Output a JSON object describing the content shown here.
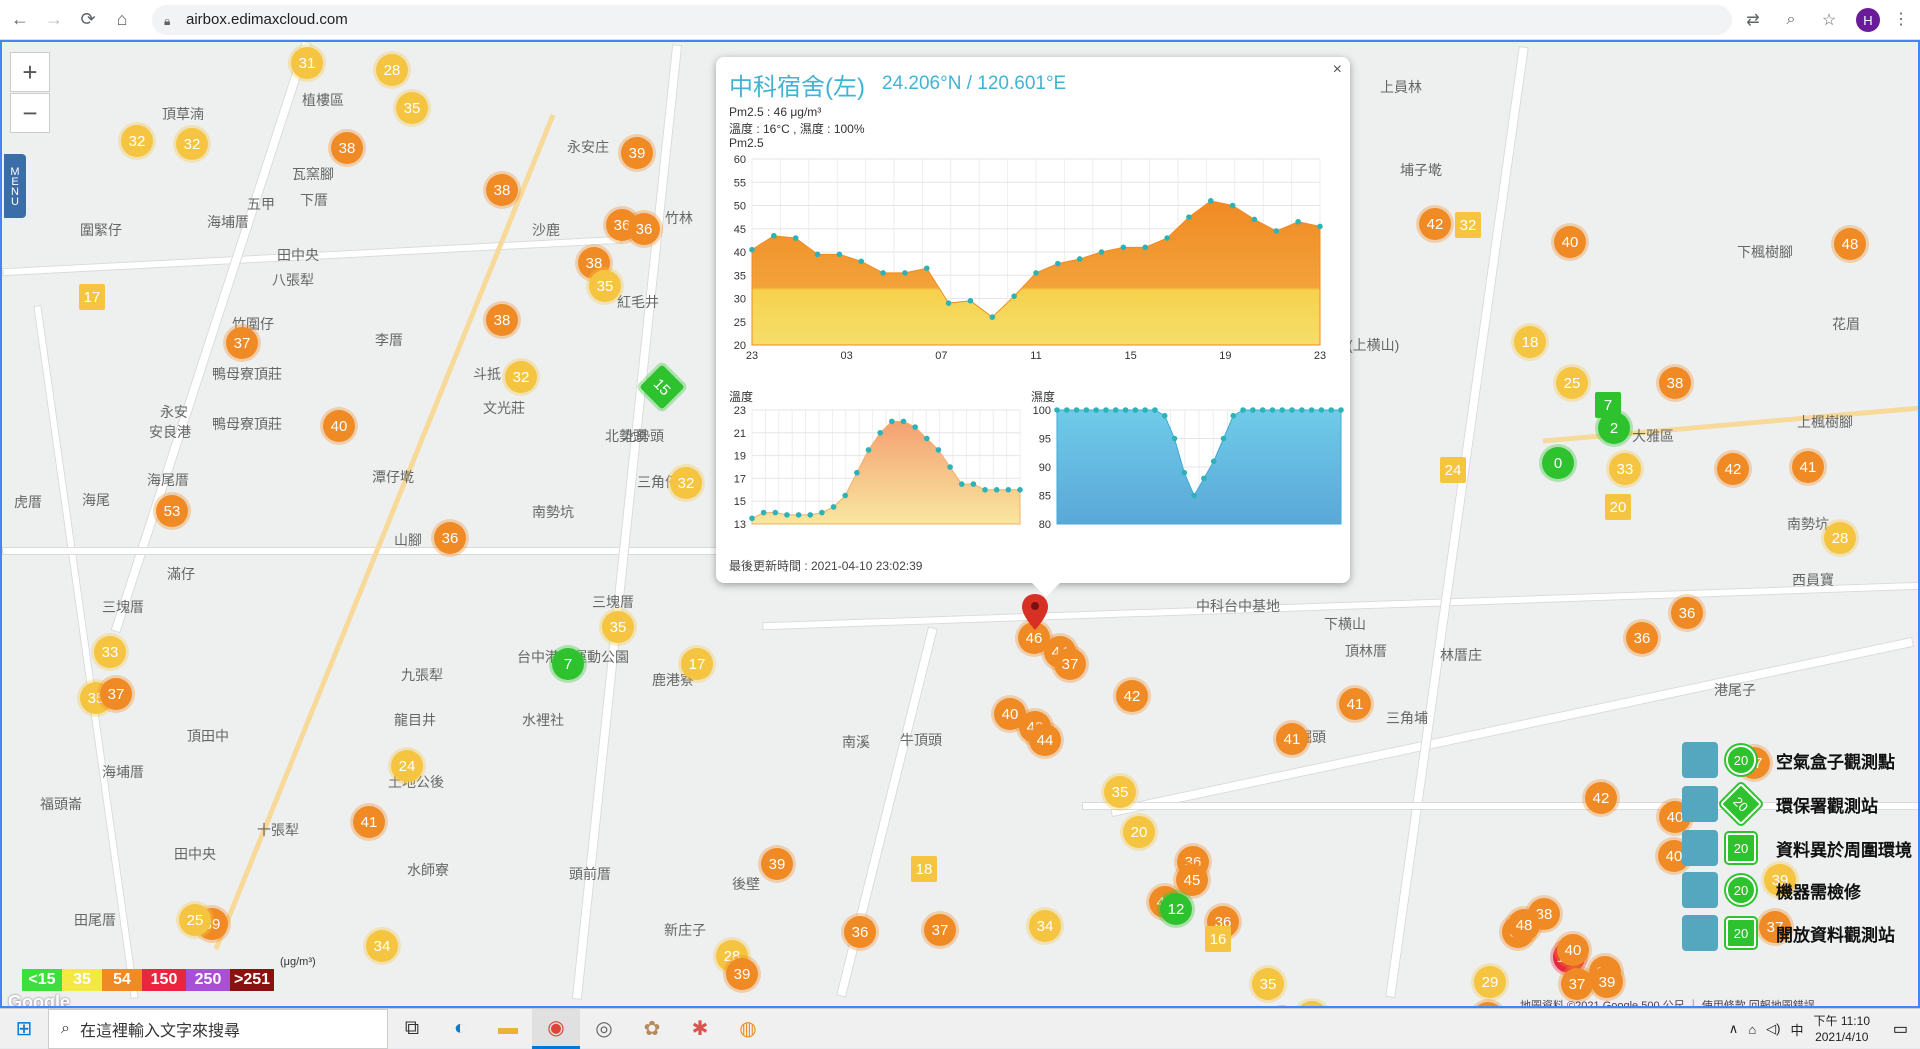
{
  "browser": {
    "url": "airbox.edimaxcloud.com",
    "avatar_letter": "H"
  },
  "map": {
    "menu_label": "MENU",
    "zoom_in": "+",
    "zoom_out": "−",
    "labels": [
      {
        "text": "植樓區"
      },
      {
        "text": "頂草湳"
      },
      {
        "text": "瓦窯腳"
      },
      {
        "text": "下厝"
      },
      {
        "text": "五甲"
      },
      {
        "text": "圍緊仔"
      },
      {
        "text": "海埔厝"
      },
      {
        "text": "田中央"
      },
      {
        "text": "八張犁"
      },
      {
        "text": "竹圍仔"
      },
      {
        "text": "鴨母寮頂莊"
      },
      {
        "text": "永安"
      },
      {
        "text": "安良港"
      },
      {
        "text": "鴨母寮頂莊"
      },
      {
        "text": "海尾厝"
      },
      {
        "text": "虎厝"
      },
      {
        "text": "海尾"
      },
      {
        "text": "滿仔"
      },
      {
        "text": "三塊厝"
      },
      {
        "text": "頂田中"
      },
      {
        "text": "海埔厝"
      },
      {
        "text": "福頭崙"
      },
      {
        "text": "田中央"
      },
      {
        "text": "田尾厝"
      },
      {
        "text": "南勢坑"
      },
      {
        "text": "山腳"
      },
      {
        "text": "九張犁"
      },
      {
        "text": "龍目井"
      },
      {
        "text": "水裡社"
      },
      {
        "text": "土地公後"
      },
      {
        "text": "十張犁"
      },
      {
        "text": "水師寮"
      },
      {
        "text": "頭前厝"
      },
      {
        "text": "後壁"
      },
      {
        "text": "新庄子"
      },
      {
        "text": "牛頂頭"
      },
      {
        "text": "中科台中基地"
      },
      {
        "text": "下横山"
      },
      {
        "text": "頂林厝"
      },
      {
        "text": "林厝庄"
      },
      {
        "text": "三角埔"
      },
      {
        "text": "秀山(上横山)"
      },
      {
        "text": "上員林"
      },
      {
        "text": "埔子墘"
      },
      {
        "text": "下楓樹腳"
      },
      {
        "text": "花眉"
      },
      {
        "text": "上楓樹腳"
      },
      {
        "text": "大雅區"
      },
      {
        "text": "南勢坑"
      },
      {
        "text": "西員寶"
      },
      {
        "text": "港尾子"
      },
      {
        "text": "水崛頭"
      },
      {
        "text": "三角仔"
      },
      {
        "text": "北勢頭"
      },
      {
        "text": "紅毛井"
      },
      {
        "text": "李厝"
      },
      {
        "text": "斗抵"
      },
      {
        "text": "文光莊"
      },
      {
        "text": "潭仔墘"
      },
      {
        "text": "永安庄"
      },
      {
        "text": "沙鹿"
      },
      {
        "text": "竹林"
      },
      {
        "text": "北勢頭"
      },
      {
        "text": "台中港區運動公園"
      },
      {
        "text": "鹿港寮"
      },
      {
        "text": "三塊厝"
      },
      {
        "text": "南溪"
      }
    ],
    "markers": [
      {
        "v": "31",
        "c": "#f5c542"
      },
      {
        "v": "28",
        "c": "#f5c542"
      },
      {
        "v": "35",
        "c": "#f5c542"
      },
      {
        "v": "32",
        "c": "#f5c542"
      },
      {
        "v": "38",
        "c": "#f08a24"
      },
      {
        "v": "32",
        "c": "#f5c542"
      },
      {
        "v": "38",
        "c": "#f08a24"
      },
      {
        "v": "39",
        "c": "#f08a24"
      },
      {
        "v": "36",
        "c": "#f08a24"
      },
      {
        "v": "36",
        "c": "#f08a24"
      },
      {
        "v": "38",
        "c": "#f08a24"
      },
      {
        "v": "35",
        "c": "#f5c542"
      },
      {
        "v": "37",
        "c": "#f08a24"
      },
      {
        "v": "38",
        "c": "#f08a24"
      },
      {
        "v": "32",
        "c": "#f5c542"
      },
      {
        "v": "40",
        "c": "#f08a24"
      },
      {
        "v": "53",
        "c": "#f08a24"
      },
      {
        "v": "36",
        "c": "#f08a24"
      },
      {
        "v": "32",
        "c": "#f5c542"
      },
      {
        "v": "35",
        "c": "#f5c542"
      },
      {
        "v": "7",
        "c": "#2ec22e"
      },
      {
        "v": "33",
        "c": "#f5c542"
      },
      {
        "v": "35",
        "c": "#f5c542"
      },
      {
        "v": "37",
        "c": "#f08a24"
      },
      {
        "v": "17",
        "c": "#f5c542"
      },
      {
        "v": "24",
        "c": "#f5c542"
      },
      {
        "v": "41",
        "c": "#f08a24"
      },
      {
        "v": "39",
        "c": "#f08a24"
      },
      {
        "v": "34",
        "c": "#f5c542"
      },
      {
        "v": "39",
        "c": "#f08a24"
      },
      {
        "v": "28",
        "c": "#f5c542"
      },
      {
        "v": "39",
        "c": "#f08a24"
      },
      {
        "v": "25",
        "c": "#f5c542"
      },
      {
        "v": "46",
        "c": "#f08a24"
      },
      {
        "v": "44",
        "c": "#f08a24"
      },
      {
        "v": "37",
        "c": "#f08a24"
      },
      {
        "v": "40",
        "c": "#f08a24"
      },
      {
        "v": "42",
        "c": "#f08a24"
      },
      {
        "v": "44",
        "c": "#f08a24"
      },
      {
        "v": "42",
        "c": "#f08a24"
      },
      {
        "v": "35",
        "c": "#f5c542"
      },
      {
        "v": "20",
        "c": "#f5c542"
      },
      {
        "v": "36",
        "c": "#f08a24"
      },
      {
        "v": "45",
        "c": "#f08a24"
      },
      {
        "v": "40",
        "c": "#f08a24"
      },
      {
        "v": "12",
        "c": "#2ec22e"
      },
      {
        "v": "36",
        "c": "#f08a24"
      },
      {
        "v": "34",
        "c": "#f5c542"
      },
      {
        "v": "37",
        "c": "#f08a24"
      },
      {
        "v": "36",
        "c": "#f08a24"
      },
      {
        "v": "39",
        "c": "#f08a24"
      },
      {
        "v": "35",
        "c": "#f5c542"
      },
      {
        "v": "33",
        "c": "#f5c542"
      },
      {
        "v": "0",
        "c": "#2ec22e"
      },
      {
        "v": "41",
        "c": "#f08a24"
      },
      {
        "v": "42",
        "c": "#f08a24"
      },
      {
        "v": "40",
        "c": "#f08a24"
      },
      {
        "v": "18",
        "c": "#f5c542"
      },
      {
        "v": "25",
        "c": "#f5c542"
      },
      {
        "v": "38",
        "c": "#f08a24"
      },
      {
        "v": "2",
        "c": "#2ec22e"
      },
      {
        "v": "0",
        "c": "#2ec22e"
      },
      {
        "v": "33",
        "c": "#f5c542"
      },
      {
        "v": "42",
        "c": "#f08a24"
      },
      {
        "v": "41",
        "c": "#f08a24"
      },
      {
        "v": "28",
        "c": "#f5c542"
      },
      {
        "v": "36",
        "c": "#f08a24"
      },
      {
        "v": "36",
        "c": "#f08a24"
      },
      {
        "v": "48",
        "c": "#f08a24"
      },
      {
        "v": "37",
        "c": "#f08a24"
      },
      {
        "v": "41",
        "c": "#f08a24"
      },
      {
        "v": "42",
        "c": "#f08a24"
      },
      {
        "v": "37",
        "c": "#f08a24"
      },
      {
        "v": "40",
        "c": "#f08a24"
      },
      {
        "v": "40",
        "c": "#f08a24"
      },
      {
        "v": "120",
        "c": "#e8273f"
      },
      {
        "v": "39",
        "c": "#f5c542"
      },
      {
        "v": "38",
        "c": "#f08a24"
      },
      {
        "v": "48",
        "c": "#f08a24"
      },
      {
        "v": "37",
        "c": "#f08a24"
      },
      {
        "v": "40",
        "c": "#f08a24"
      },
      {
        "v": "39",
        "c": "#f08a24"
      },
      {
        "v": "37",
        "c": "#f08a24"
      },
      {
        "v": "29",
        "c": "#f5c542"
      },
      {
        "v": "39",
        "c": "#f08a24"
      },
      {
        "v": "37",
        "c": "#f08a24"
      },
      {
        "v": "15",
        "c": "#2ec22e"
      }
    ],
    "sq_markers": [
      {
        "v": "17",
        "c": "#f5c542"
      },
      {
        "v": "32",
        "c": "#f5c542"
      },
      {
        "v": "24",
        "c": "#f5c542"
      },
      {
        "v": "7",
        "c": "#2ec22e"
      },
      {
        "v": "20",
        "c": "#f5c542"
      },
      {
        "v": "18",
        "c": "#f5c542"
      },
      {
        "v": "16",
        "c": "#f5c542"
      }
    ]
  },
  "popup": {
    "title": "中科宿舍(左)",
    "coord": "24.206°N / 120.601°E",
    "pm_line": "Pm2.5 : 46 μg/m³",
    "temp_line": "溫度 : 16°C , 濕度 : 100%",
    "pm_chart_label": "Pm2.5",
    "temp_chart_label": "溫度",
    "humid_chart_label": "濕度",
    "updated": "最後更新時間 : 2021-04-10 23:02:39",
    "close": "×"
  },
  "chart_data": [
    {
      "type": "area",
      "title": "Pm2.5",
      "x_ticks": [
        "23",
        "03",
        "07",
        "11",
        "15",
        "19",
        "23"
      ],
      "ylim": [
        20,
        60
      ],
      "y_ticks": [
        20,
        25,
        30,
        35,
        40,
        45,
        50,
        55,
        60
      ],
      "values": [
        40.5,
        43.5,
        43,
        39.5,
        39.5,
        38,
        35.5,
        35.5,
        36.5,
        29,
        29.5,
        26,
        30.5,
        35.5,
        37.5,
        38.5,
        40,
        41,
        41,
        43,
        47.5,
        51,
        50,
        47,
        44.5,
        46.5,
        45.5
      ]
    },
    {
      "type": "area",
      "title": "溫度",
      "ylim": [
        13,
        23
      ],
      "y_ticks": [
        13,
        15,
        17,
        19,
        21,
        23
      ],
      "values": [
        13.5,
        14,
        14,
        13.8,
        13.8,
        13.8,
        14,
        14.5,
        15.5,
        17.5,
        19.5,
        21,
        22,
        22,
        21.5,
        20.5,
        19.5,
        18,
        16.5,
        16.5,
        16,
        16,
        16,
        16
      ]
    },
    {
      "type": "area",
      "title": "濕度",
      "ylim": [
        80,
        100
      ],
      "y_ticks": [
        80,
        85,
        90,
        95,
        100
      ],
      "values": [
        100,
        100,
        100,
        100,
        100,
        100,
        100,
        100,
        100,
        100,
        100,
        99,
        95,
        89,
        85,
        88,
        91,
        95,
        99,
        100,
        100,
        100,
        100,
        100,
        100,
        100,
        100,
        100,
        100,
        100
      ]
    }
  ],
  "aqi_legend": [
    {
      "label": "<15",
      "color": "#3ce03c"
    },
    {
      "label": "35",
      "color": "#f5e842"
    },
    {
      "label": "54",
      "color": "#f08a24"
    },
    {
      "label": "150",
      "color": "#e8273f"
    },
    {
      "label": "250",
      "color": "#a84fd6"
    },
    {
      "label": ">251",
      "color": "#8b1111"
    }
  ],
  "aqi_unit": "(μg/m³)",
  "google_logo": "Google",
  "right_legend": [
    {
      "badge": "20",
      "label": "空氣盒子觀測點"
    },
    {
      "badge": "20",
      "label": "環保署觀測站"
    },
    {
      "badge": "20",
      "label": "資料異於周圍環境"
    },
    {
      "badge": "20",
      "label": "機器需檢修"
    },
    {
      "badge": "20",
      "label": "開放資料觀測站"
    }
  ],
  "attribution": "地圖資料 ©2021 Google   500 公尺 ⎿      使用條款   回報地圖錯誤",
  "taskbar": {
    "search_placeholder": "在這裡輸入文字來搜尋",
    "time": "下午 11:10",
    "date": "2021/4/10",
    "ime": "中"
  }
}
